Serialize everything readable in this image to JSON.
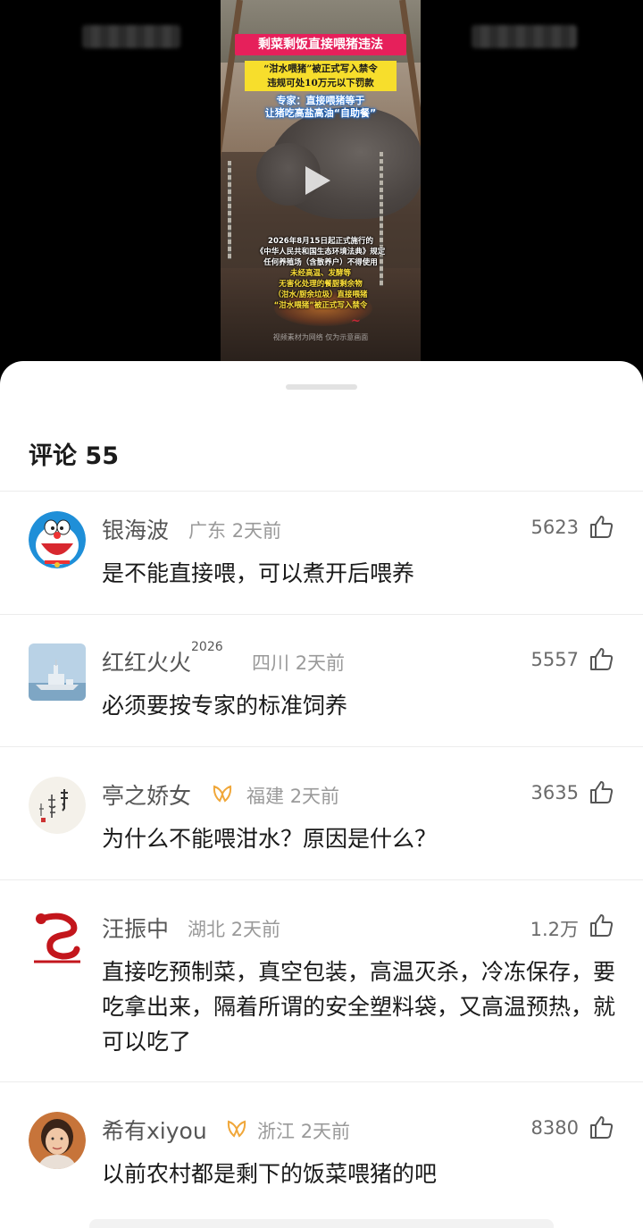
{
  "video": {
    "title": "剩菜剩饭直接喂猪违法",
    "box_line1": "“泔水喂猪”被正式写入禁令",
    "box_line2": "违规可处10万元以下罚款",
    "expert_line1": "专家：直接喂猪等于",
    "expert_line2": "让猪吃高盐高油“自助餐”",
    "notice": [
      "2026年8月15日起正式施行的",
      "《中华人民共和国生态环境法典》规定",
      "任何养殖场（含散养户）不得使用",
      "未经高温、发酵等",
      "无害化处理的餐厨剩余物",
      "（泔水/厨余垃圾）直接喂猪",
      "“泔水喂猪”被正式写入禁令"
    ],
    "caption": "视频素材为网络 仅为示意画面",
    "play_icon": "play-icon"
  },
  "comments_header": {
    "label": "评论",
    "count": "55"
  },
  "comments": [
    {
      "name": "银海波",
      "name_sup": "",
      "location": "广东",
      "time": "2天前",
      "text": "是不能直接喂，可以煮开后喂养",
      "likes": "5623",
      "vip": false,
      "avatar": "doraemon-avatar"
    },
    {
      "name": "红红火火",
      "name_sup": "2026",
      "location": "四川",
      "time": "2天前",
      "text": "必须要按专家的标准饲养",
      "likes": "5557",
      "vip": false,
      "avatar": "warship-avatar"
    },
    {
      "name": "亭之娇女",
      "name_sup": "",
      "location": "福建",
      "time": "2天前",
      "text": "为什么不能喂泔水？原因是什么？",
      "likes": "3635",
      "vip": true,
      "avatar": "calligraphy-avatar"
    },
    {
      "name": "汪振中",
      "name_sup": "",
      "location": "湖北",
      "time": "2天前",
      "text": "直接吃预制菜，真空包装，高温灭杀，冷冻保存，要吃拿出来，隔着所谓的安全塑料袋，又高温预热，就可以吃了",
      "likes": "1.2万",
      "vip": false,
      "avatar": "red-snake-avatar"
    },
    {
      "name": "希有xiyou",
      "name_sup": "",
      "location": "浙江",
      "time": "2天前",
      "text": "以前农村都是剩下的饭菜喂猪的吧",
      "likes": "8380",
      "vip": true,
      "avatar": "woman-portrait-avatar"
    }
  ],
  "colors": {
    "vip_badge": "#f0a73a",
    "like_icon": "#555555",
    "video_title_bg": "#e6205b",
    "video_box_bg": "#f7de2c"
  }
}
